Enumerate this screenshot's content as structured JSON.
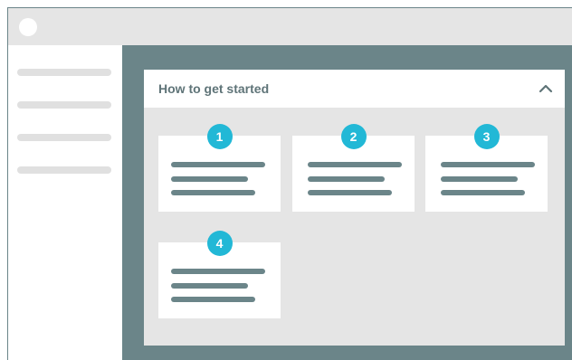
{
  "panel": {
    "title": "How to get started",
    "collapse_icon": "chevron-up-icon"
  },
  "steps": [
    {
      "number": "1"
    },
    {
      "number": "2"
    },
    {
      "number": "3"
    },
    {
      "number": "4"
    }
  ],
  "colors": {
    "accent": "#22b8d6",
    "frame": "#6b8589",
    "panel_bg": "#e5e5e5",
    "card_bg": "#ffffff",
    "title_text": "#5f7478"
  }
}
